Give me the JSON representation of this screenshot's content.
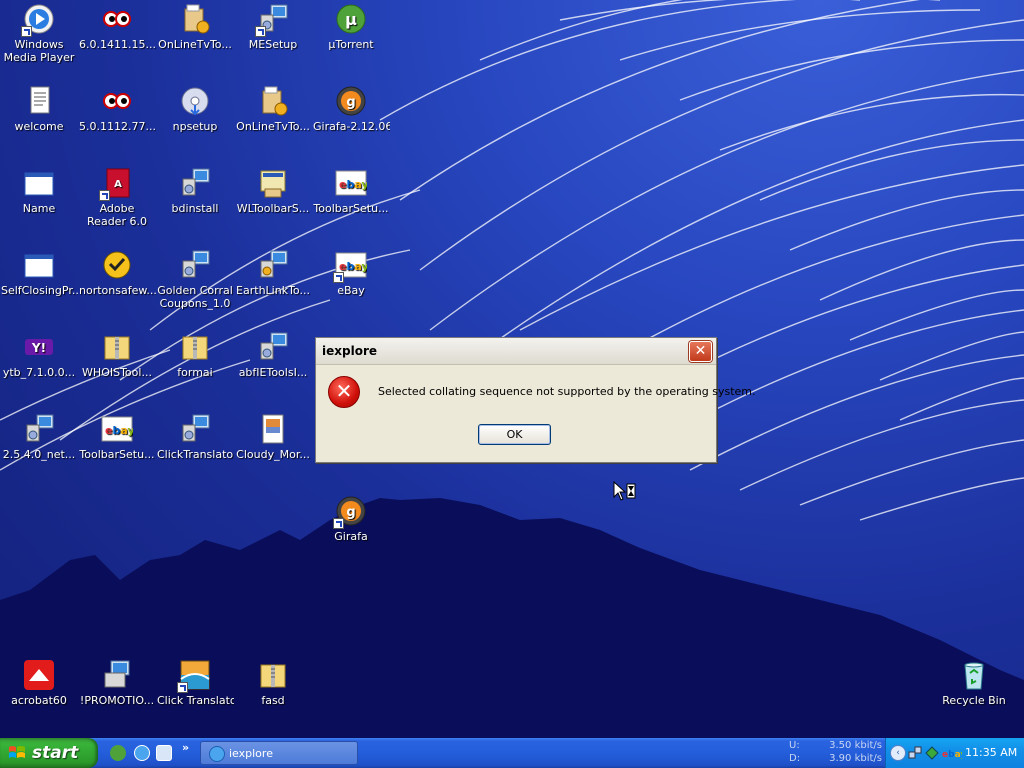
{
  "desktop": {
    "icons": [
      {
        "label": "Windows Media Player"
      },
      {
        "label": "6.0.1411.15..."
      },
      {
        "label": "OnLineTvTo..."
      },
      {
        "label": "MESetup"
      },
      {
        "label": "µTorrent"
      },
      {
        "label": "welcome"
      },
      {
        "label": "5.0.1112.77..."
      },
      {
        "label": "npsetup"
      },
      {
        "label": "OnLineTvTo..."
      },
      {
        "label": "Girafa-2.12.06"
      },
      {
        "label": "Name"
      },
      {
        "label": "Adobe Reader 6.0"
      },
      {
        "label": "bdinstall"
      },
      {
        "label": "WLToolbarS..."
      },
      {
        "label": "ToolbarSetu..."
      },
      {
        "label": "SelfClosingPr..."
      },
      {
        "label": "nortonsafew..."
      },
      {
        "label": "Golden Corral Coupons_1.0"
      },
      {
        "label": "EarthLinkTo..."
      },
      {
        "label": "eBay"
      },
      {
        "label": "ytb_7.1.0.0..."
      },
      {
        "label": "WHOISTool..."
      },
      {
        "label": "formai"
      },
      {
        "label": "abfIEToolsI..."
      },
      {
        "label": "2.5.4.0_net..."
      },
      {
        "label": "ToolbarSetu..."
      },
      {
        "label": "ClickTranslator"
      },
      {
        "label": "Cloudy_Mor..."
      },
      {
        "label": "Girafa"
      },
      {
        "label": "acrobat60"
      },
      {
        "label": "!PROMOTIO..."
      },
      {
        "label": "Click Translator"
      },
      {
        "label": "fasd"
      },
      {
        "label": "Recycle Bin"
      }
    ]
  },
  "dialog": {
    "title": "iexplore",
    "close_glyph": "✕",
    "error_glyph": "✕",
    "message": "Selected collating sequence not supported by the operating system.",
    "ok_label": "OK"
  },
  "taskbar": {
    "start_label": "start",
    "quicklaunch_more": "»",
    "task_label": "iexplore",
    "netmon": [
      {
        "key": "U:",
        "value": "3.50 kbit/s"
      },
      {
        "key": "D:",
        "value": "3.90 kbit/s"
      }
    ],
    "tray_expand": "‹",
    "clock": "11:35 AM"
  },
  "colors": {
    "desktop_blue": "#1b2f9a",
    "mountain": "#0a0e5a",
    "taskbar_blue": "#245edb",
    "start_green": "#38b338",
    "tray_blue": "#1290e8",
    "dialog_bg": "#ece9d8",
    "error_red": "#d0100a"
  }
}
